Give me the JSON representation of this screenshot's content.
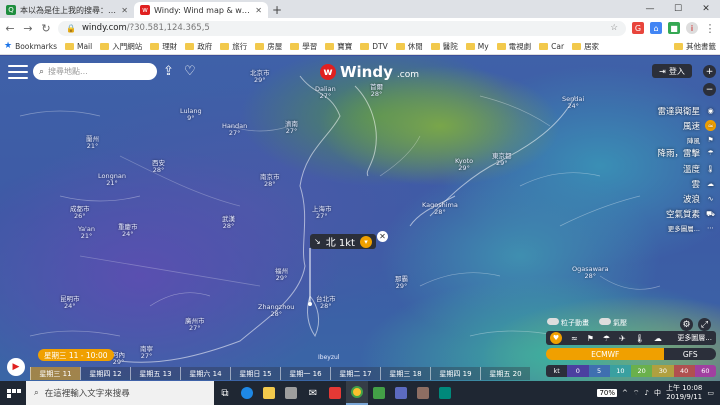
{
  "browser": {
    "tabs": [
      {
        "title": "本以為是住上我的搜尋：越南向",
        "active": false,
        "icon_color": "#1e8e3e"
      },
      {
        "title": "Windy: Wind map & weather fo",
        "active": true,
        "icon_color": "#e02020"
      }
    ],
    "new_tab": "+",
    "url_host": "windy.com",
    "url_path": "/?30.581,124.365,5",
    "bookmarks": [
      "Bookmarks",
      "Mail",
      "入門網站",
      "理財",
      "政府",
      "旅行",
      "房屋",
      "學習",
      "寶寶",
      "DTV",
      "休閒",
      "醫院",
      "My",
      "電視劇",
      "Car",
      "居家"
    ],
    "other_bookmarks": "其他書籤"
  },
  "map": {
    "search_placeholder": "搜尋地點...",
    "logo": "Windy",
    "logo_suffix": ".com",
    "login_label": "登入",
    "layers": [
      {
        "label": "雷達與衛星",
        "icon": "radar-icon",
        "selected": false
      },
      {
        "label": "風速",
        "icon": "wind-icon",
        "selected": true
      },
      {
        "label": "陣風",
        "icon": "gust-icon",
        "selected": false,
        "small": true
      },
      {
        "label": "降雨，雷擊",
        "icon": "rain-icon",
        "selected": false
      },
      {
        "label": "溫度",
        "icon": "thermometer-icon",
        "selected": false
      },
      {
        "label": "雲",
        "icon": "cloud-icon",
        "selected": false
      },
      {
        "label": "波浪",
        "icon": "wave-icon",
        "selected": false
      },
      {
        "label": "空氣質素",
        "icon": "air-quality-icon",
        "selected": false
      },
      {
        "label": "更多圖層...",
        "icon": "more-icon",
        "selected": false,
        "small": true
      }
    ],
    "popup": {
      "text": "北 1kt"
    },
    "cities": [
      {
        "name": "北京市",
        "temp": "29°"
      },
      {
        "name": "Dalian",
        "temp": "27°"
      },
      {
        "name": "首爾",
        "temp": "28°"
      },
      {
        "name": "Sendai",
        "temp": "24°"
      },
      {
        "name": "Handan",
        "temp": "27°"
      },
      {
        "name": "濟南",
        "temp": "27°"
      },
      {
        "name": "Kyoto",
        "temp": "29°"
      },
      {
        "name": "東京都",
        "temp": "29°"
      },
      {
        "name": "蘭州",
        "temp": "21°"
      },
      {
        "name": "Lulang",
        "temp": "9°"
      },
      {
        "name": "西安",
        "temp": "28°"
      },
      {
        "name": "南京市",
        "temp": "28°"
      },
      {
        "name": "上海市",
        "temp": "27°"
      },
      {
        "name": "Kagoshima",
        "temp": "28°"
      },
      {
        "name": "成都市",
        "temp": "26°"
      },
      {
        "name": "武漢",
        "temp": "28°"
      },
      {
        "name": "重慶市",
        "temp": "24°"
      },
      {
        "name": "福州",
        "temp": "29°"
      },
      {
        "name": "Zhangzhou",
        "temp": "28°"
      },
      {
        "name": "台北市",
        "temp": "28°"
      },
      {
        "name": "廣州市",
        "temp": "27°"
      },
      {
        "name": "那霸",
        "temp": "29°"
      },
      {
        "name": "Ogasawara",
        "temp": "28°"
      },
      {
        "name": "Longnan",
        "temp": "21°"
      },
      {
        "name": "Ya'an",
        "temp": "21°"
      },
      {
        "name": "昆明市",
        "temp": "24°"
      },
      {
        "name": "南寧",
        "temp": "27°"
      },
      {
        "name": "河內",
        "temp": "29°"
      }
    ],
    "options": {
      "particles": "粒子動畫",
      "pressure": "氣壓"
    },
    "more_layers": "更多圖層...",
    "models": {
      "ecmwf": "ECMWF",
      "gfs": "GFS"
    },
    "legend": {
      "unit": "kt",
      "values": [
        "0",
        "5",
        "10",
        "20",
        "30",
        "40",
        "60"
      ]
    },
    "current_time": "星期三 11 - 10:00",
    "days": [
      "星期三 11",
      "星期四 12",
      "星期五 13",
      "星期六 14",
      "星期日 15",
      "星期一 16",
      "星期二 17",
      "星期三 18",
      "星期四 19",
      "星期五 20"
    ],
    "current_day_index": 0,
    "ibeyzul": "Ibeyzul"
  },
  "taskbar": {
    "search_placeholder": "在這裡輸入文字來搜尋",
    "battery": "70%",
    "time": "上午 10:08",
    "date": "2019/9/11"
  }
}
